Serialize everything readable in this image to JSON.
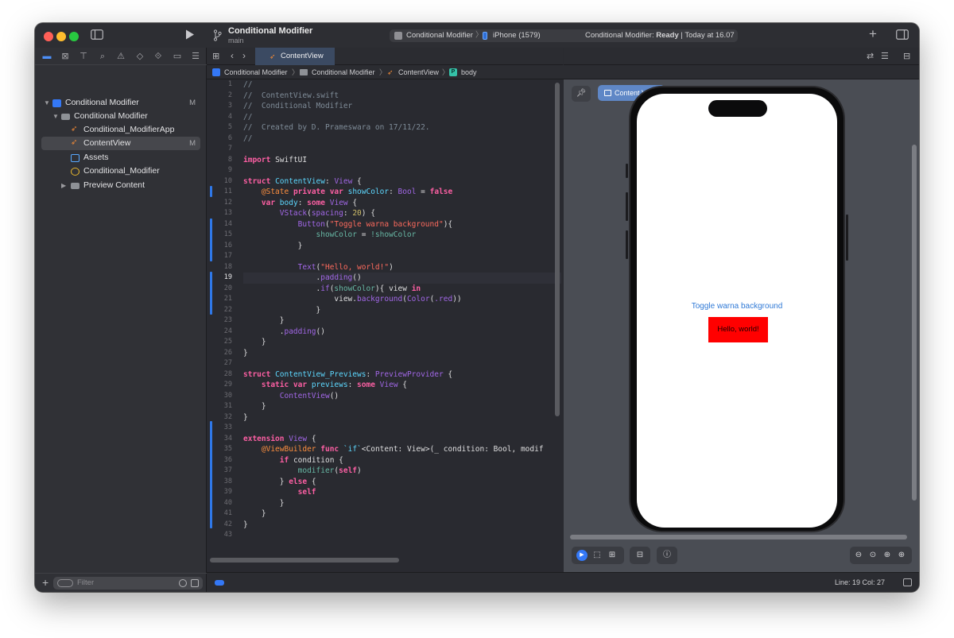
{
  "window": {
    "project_title": "Conditional Modifier",
    "branch": "main",
    "scheme": "Conditional Modifier",
    "device": "iPhone (1579)",
    "status_prefix": "Conditional Modifier:",
    "status_state": "Ready",
    "status_time": "| Today at 16.07"
  },
  "navigator": {
    "items": [
      {
        "label": "Conditional Modifier",
        "badge": "M"
      },
      {
        "label": "Conditional Modifier",
        "badge": ""
      },
      {
        "label": "Conditional_ModifierApp",
        "badge": ""
      },
      {
        "label": "ContentView",
        "badge": "M"
      },
      {
        "label": "Assets",
        "badge": ""
      },
      {
        "label": "Conditional_Modifier",
        "badge": ""
      },
      {
        "label": "Preview Content",
        "badge": ""
      }
    ],
    "filter_placeholder": "Filter"
  },
  "editor": {
    "tab_label": "ContentView",
    "jump": [
      "Conditional Modifier",
      "Conditional Modifier",
      "ContentView",
      "body"
    ],
    "line_numbers": [
      "1",
      "2",
      "3",
      "4",
      "5",
      "6",
      "7",
      "8",
      "9",
      "10",
      "11",
      "12",
      "13",
      "14",
      "15",
      "16",
      "17",
      "18",
      "19",
      "20",
      "21",
      "22",
      "23",
      "24",
      "25",
      "26",
      "27",
      "28",
      "29",
      "30",
      "31",
      "32",
      "33",
      "34",
      "35",
      "36",
      "37",
      "38",
      "39",
      "40",
      "41",
      "42",
      "43"
    ],
    "code": {
      "l2": "ContentView.swift",
      "l3": "Conditional Modifier",
      "l5": "Created by D. Prameswara on 17/11/22.",
      "l8_kw": "import",
      "l8": "SwiftUI",
      "l10_kw": "struct",
      "l10_name": "ContentView",
      "l10_type": "View",
      "l11_attr": "@State",
      "l11_kw": "private var",
      "l11_name": "showColor",
      "l11_type": "Bool",
      "l11_val": "false",
      "l12_kw": "var",
      "l12_name": "body",
      "l12_kw2": "some",
      "l12_type": "View",
      "l13_fn": "VStack",
      "l13_arg": "spacing",
      "l13_num": "20",
      "l14_fn": "Button",
      "l14_str": "\"Toggle warna background\"",
      "l15_a": "showColor",
      "l15_b": "!showColor",
      "l18_fn": "Text",
      "l18_str": "\"Hello, world!\"",
      "l19_mod": "padding",
      "l20_mod": "if",
      "l20_arg": "showColor",
      "l20_rest": "view",
      "l20_kw": "in",
      "l21_a": "view",
      "l21_mod": "background",
      "l21_fn": "Color",
      "l21_arg": ".red",
      "l24_mod": "padding",
      "l28_kw": "struct",
      "l28_name": "ContentView_Previews",
      "l28_type": "PreviewProvider",
      "l29_kw": "static var",
      "l29_name": "previews",
      "l29_kw2": "some",
      "l29_type": "View",
      "l30_fn": "ContentView",
      "l34_kw": "extension",
      "l34_type": "View",
      "l35_attr": "@ViewBuilder",
      "l35_kw": "func",
      "l35_name": "`if`",
      "l35_rest": "<Content: View>(_ condition: Bool, modif",
      "l36_kw": "if",
      "l36_rest": "condition {",
      "l37_fn": "modifier",
      "l37_kw": "self",
      "l38_kw": "else",
      "l39_kw": "self"
    }
  },
  "preview": {
    "chip_label": "Content View",
    "button_text": "Toggle warna background",
    "hello_text": "Hello, world!",
    "hello_color": "#ff0000",
    "link_color": "#2f79d6"
  },
  "statusbar": {
    "position": "Line: 19  Col: 27"
  },
  "colors": {
    "keyword": "#fc5fa3",
    "comment": "#7f8c98",
    "string": "#fc6a5d",
    "type": "#5dd8ff",
    "selection_tab": "#3b4a62",
    "accent": "#3478f6"
  }
}
